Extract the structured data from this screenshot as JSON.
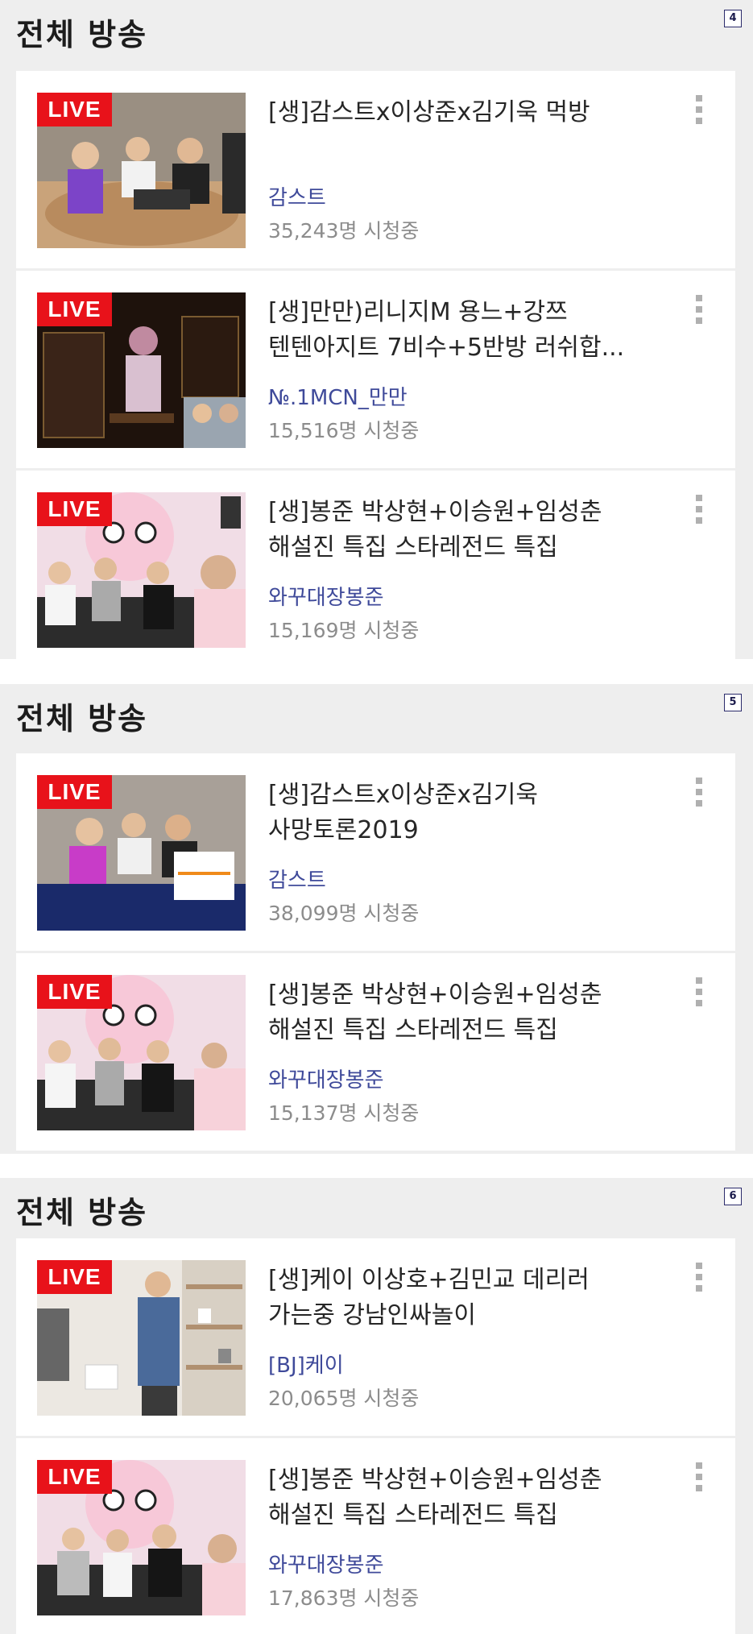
{
  "panels": [
    {
      "title": "전체 방송",
      "page": "4",
      "cards": [
        {
          "live": "LIVE",
          "title1": "[생]감스트x이상준x김기욱 먹방",
          "title2": "",
          "channel": "감스트",
          "viewers": "35,243명 시청중"
        },
        {
          "live": "LIVE",
          "title1": "[생]만만)리니지M 용느+강쯔",
          "title2": "텐텐아지트 7비수+5반방 러쉬합...",
          "channel": "№.1MCN_만만",
          "viewers": "15,516명 시청중"
        },
        {
          "live": "LIVE",
          "title1": "[생]봉준 박상현+이승원+임성춘",
          "title2": "해설진 특집 스타레전드 특집",
          "channel": "와꾸대장봉준",
          "viewers": "15,169명 시청중"
        }
      ]
    },
    {
      "title": "전체 방송",
      "page": "5",
      "cards": [
        {
          "live": "LIVE",
          "title1": "[생]감스트x이상준x김기욱",
          "title2": "사망토론2019",
          "channel": "감스트",
          "viewers": "38,099명 시청중"
        },
        {
          "live": "LIVE",
          "title1": "[생]봉준 박상현+이승원+임성춘",
          "title2": "해설진 특집 스타레전드 특집",
          "channel": "와꾸대장봉준",
          "viewers": "15,137명 시청중"
        }
      ]
    },
    {
      "title": "전체 방송",
      "page": "6",
      "cards": [
        {
          "live": "LIVE",
          "title1": "[생]케이 이상호+김민교 데리러",
          "title2": "가는중 강남인싸놀이",
          "channel": "[BJ]케이",
          "viewers": "20,065명 시청중"
        },
        {
          "live": "LIVE",
          "title1": "[생]봉준 박상현+이승원+임성춘",
          "title2": "해설진 특집 스타레전드 특집",
          "channel": "와꾸대장봉준",
          "viewers": "17,863명 시청중"
        }
      ]
    }
  ],
  "icons": {
    "more": "more-vertical-icon"
  },
  "colors": {
    "live": "#e8121a",
    "channel": "#3f4a9a",
    "viewers": "#8c8c8c",
    "panel_bg": "#eeeeee"
  }
}
